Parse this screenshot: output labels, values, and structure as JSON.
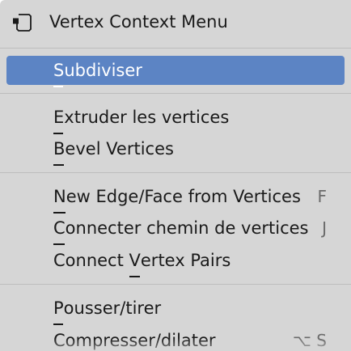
{
  "menu": {
    "title": "Vertex Context Menu",
    "title_icon": "vertex-select-icon",
    "colors": {
      "background": "#d6d6d6",
      "highlight": "#5c84c4",
      "text": "#1a1a1a",
      "shortcut_text": "#6b6b6b",
      "separator": "#bdbdbd"
    },
    "items": [
      {
        "pre": "",
        "ul": "S",
        "post": "ubdiviser",
        "shortcut": "",
        "highlighted": true
      },
      {
        "pre": "",
        "ul": "E",
        "post": "xtruder les vertices",
        "shortcut": ""
      },
      {
        "pre": "",
        "ul": "B",
        "post": "evel Vertices",
        "shortcut": ""
      },
      {
        "pre": "",
        "ul": "N",
        "post": "ew Edge/Face from Vertices",
        "shortcut": "F"
      },
      {
        "pre": "",
        "ul": "C",
        "post": "onnecter chemin de vertices",
        "shortcut": "J"
      },
      {
        "pre": "Connect ",
        "ul": "V",
        "post": "ertex Pairs",
        "shortcut": ""
      },
      {
        "pre": "",
        "ul": "P",
        "post": "ousser/tirer",
        "shortcut": ""
      },
      {
        "pre": "Compresser/dilater",
        "ul": "",
        "post": "",
        "shortcut": "⌥ S"
      }
    ]
  }
}
